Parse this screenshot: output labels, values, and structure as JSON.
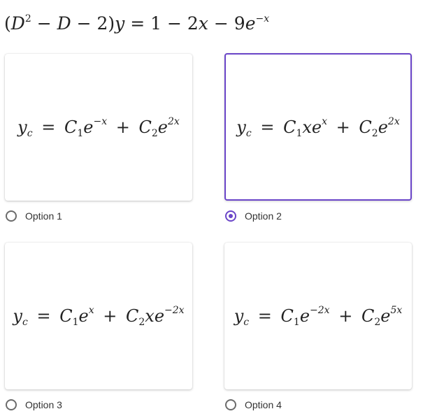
{
  "question": {
    "D": "D",
    "exp2": "2",
    "minus": "−",
    "two": "2",
    "y": "y",
    "eq": "=",
    "one": "1",
    "twox": "2",
    "x": "x",
    "nine": "9",
    "e": "e",
    "exp": "−x"
  },
  "options": [
    {
      "label": "Option 1",
      "selected": false,
      "formula": {
        "y": "y",
        "sub_y": "c",
        "C1": "C",
        "s1": "1",
        "t1": "",
        "e1": "e",
        "p1": "−x",
        "plus": "+",
        "C2": "C",
        "s2": "2",
        "t2": "",
        "e2": "e",
        "p2": "2x"
      }
    },
    {
      "label": "Option 2",
      "selected": true,
      "formula": {
        "y": "y",
        "sub_y": "c",
        "C1": "C",
        "s1": "1",
        "t1": "x",
        "e1": "e",
        "p1": "x",
        "plus": "+",
        "C2": "C",
        "s2": "2",
        "t2": "",
        "e2": "e",
        "p2": "2x"
      }
    },
    {
      "label": "Option 3",
      "selected": false,
      "formula": {
        "y": "y",
        "sub_y": "c",
        "C1": "C",
        "s1": "1",
        "t1": "",
        "e1": "e",
        "p1": "x",
        "plus": "+",
        "C2": "C",
        "s2": "2",
        "t2": "x",
        "e2": "e",
        "p2": "−2x"
      }
    },
    {
      "label": "Option 4",
      "selected": false,
      "formula": {
        "y": "y",
        "sub_y": "c",
        "C1": "C",
        "s1": "1",
        "t1": "",
        "e1": "e",
        "p1": "−2x",
        "plus": "+",
        "C2": "C",
        "s2": "2",
        "t2": "",
        "e2": "e",
        "p2": "5x"
      }
    }
  ],
  "colors": {
    "accent": "#6a45c8",
    "radio_border": "#6b6b6b"
  }
}
